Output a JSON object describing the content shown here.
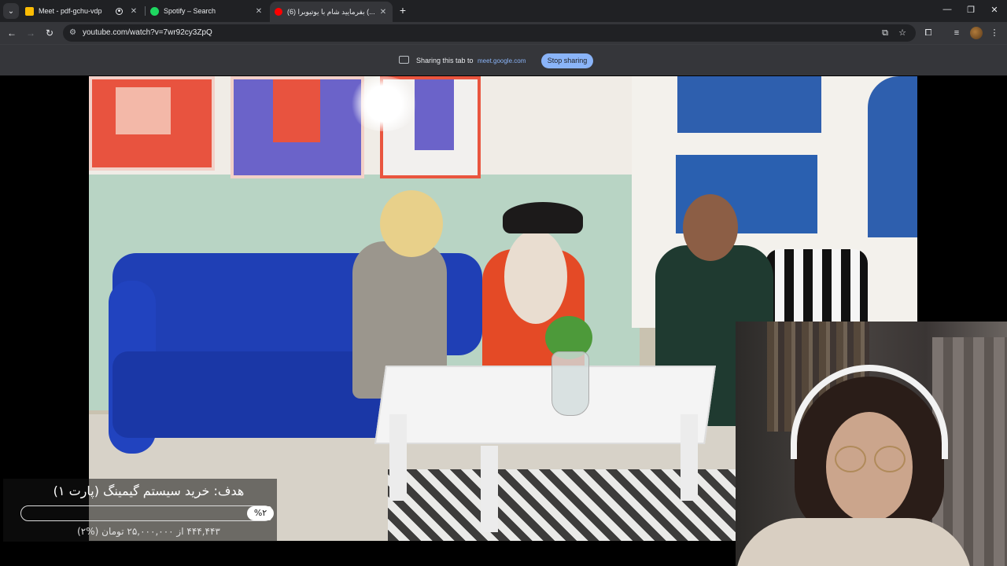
{
  "browser": {
    "tabs": [
      {
        "label": "Meet - pdf-gchu-vdp",
        "icon": "meet-icon",
        "recording": true
      },
      {
        "label": "Spotify – Search",
        "icon": "spotify-icon"
      },
      {
        "label": "(6) بفرمایید شام با یوتیوبرا (...",
        "icon": "youtube-icon",
        "active": true
      }
    ],
    "url": "youtube.com/watch?v=7wr92cy3ZpQ"
  },
  "share_bar": {
    "text": "Sharing this tab to",
    "target": "meet.google.com",
    "stop_label": "Stop sharing"
  },
  "goal_overlay": {
    "title": "هدف: خرید سیستم گیمینگ (پارت ۱)",
    "badge": "%۲",
    "progress": 0.02,
    "subtitle": "۴۴۴,۴۴۳ از ۲۵,۰۰۰,۰۰۰ تومان (%۲)"
  },
  "colors": {
    "accent_blue": "#8ab4f8",
    "chrome_dark": "#202124",
    "chrome_mid": "#35363a",
    "youtube_red": "#ff0000",
    "spotify_green": "#1ed760",
    "meet_yellow": "#fbbc04"
  }
}
